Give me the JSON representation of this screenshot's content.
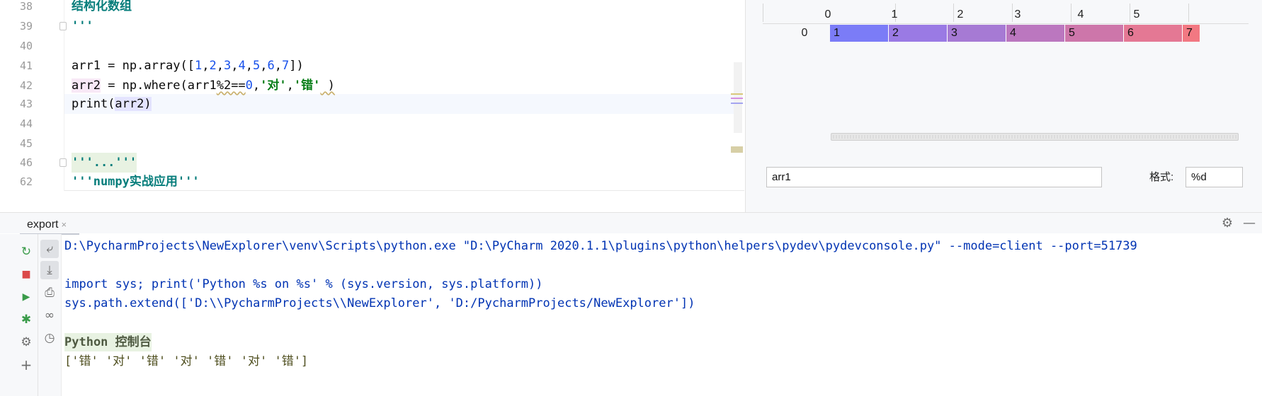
{
  "editor": {
    "lines": [
      {
        "num": "38",
        "text": "结构化数组"
      },
      {
        "num": "39",
        "text": "'''"
      },
      {
        "num": "40",
        "text": ""
      },
      {
        "num": "41",
        "arr": "arr1 = np.array([",
        "vals": [
          "1",
          "2",
          "3",
          "4",
          "5",
          "6",
          "7"
        ],
        "tail": "])"
      },
      {
        "num": "42",
        "a": "arr2",
        "b": " = np.where(arr1",
        "c": "%2==",
        "d": "0",
        "e": ",",
        "f": "'对'",
        "g": ",",
        "h": "'错'",
        "i": " )"
      },
      {
        "num": "43",
        "a": "print(",
        "b": "arr2",
        "c": ")"
      },
      {
        "num": "44",
        "text": ""
      },
      {
        "num": "45",
        "text": ""
      },
      {
        "num": "46",
        "text": "'''...'''"
      },
      {
        "num": "62",
        "text": "'''numpy实战应用'''"
      }
    ]
  },
  "viewer": {
    "columns": [
      "0",
      "1",
      "2",
      "3",
      "4",
      "5"
    ],
    "row_label": "0",
    "cells": [
      {
        "value": "1",
        "color": "#7b7cf7"
      },
      {
        "value": "2",
        "color": "#9a7ae4"
      },
      {
        "value": "3",
        "color": "#a67ad4"
      },
      {
        "value": "4",
        "color": "#bb77bf"
      },
      {
        "value": "5",
        "color": "#cd76aa"
      },
      {
        "value": "6",
        "color": "#e47894"
      },
      {
        "value": "7",
        "color": "#f27882"
      }
    ],
    "expression": "arr1",
    "format_label": "格式:",
    "format_value": "%d"
  },
  "console": {
    "tab_label": "export",
    "tab_close": "×",
    "lines": [
      "D:\\PycharmProjects\\NewExplorer\\venv\\Scripts\\python.exe \"D:\\PyCharm 2020.1.1\\plugins\\python\\helpers\\pydev\\pydevconsole.py\" --mode=client --port=51739",
      "",
      "import sys; print('Python %s on %s' % (sys.version, sys.platform))",
      "sys.path.extend(['D:\\\\PycharmProjects\\\\NewExplorer', 'D:/PycharmProjects/NewExplorer'])",
      "",
      "Python 控制台",
      "['错' '对' '错' '对' '错' '对' '错']"
    ],
    "left_tools": [
      "rerun-icon",
      "stop-icon",
      "run-icon",
      "debug-icon",
      "settings-icon",
      "add-icon"
    ],
    "left_glyphs": [
      "↻",
      "■",
      "▶",
      "✱",
      "⚙",
      "+"
    ],
    "right_tools": [
      "soft-wrap-icon",
      "scroll-to-end-icon",
      "print-icon",
      "show-variables-icon",
      "history-icon"
    ],
    "right_glyphs": [
      "⤶",
      "⤓",
      "⎙",
      "∞",
      "◷"
    ],
    "header_icons": [
      "⚙",
      "—"
    ]
  }
}
